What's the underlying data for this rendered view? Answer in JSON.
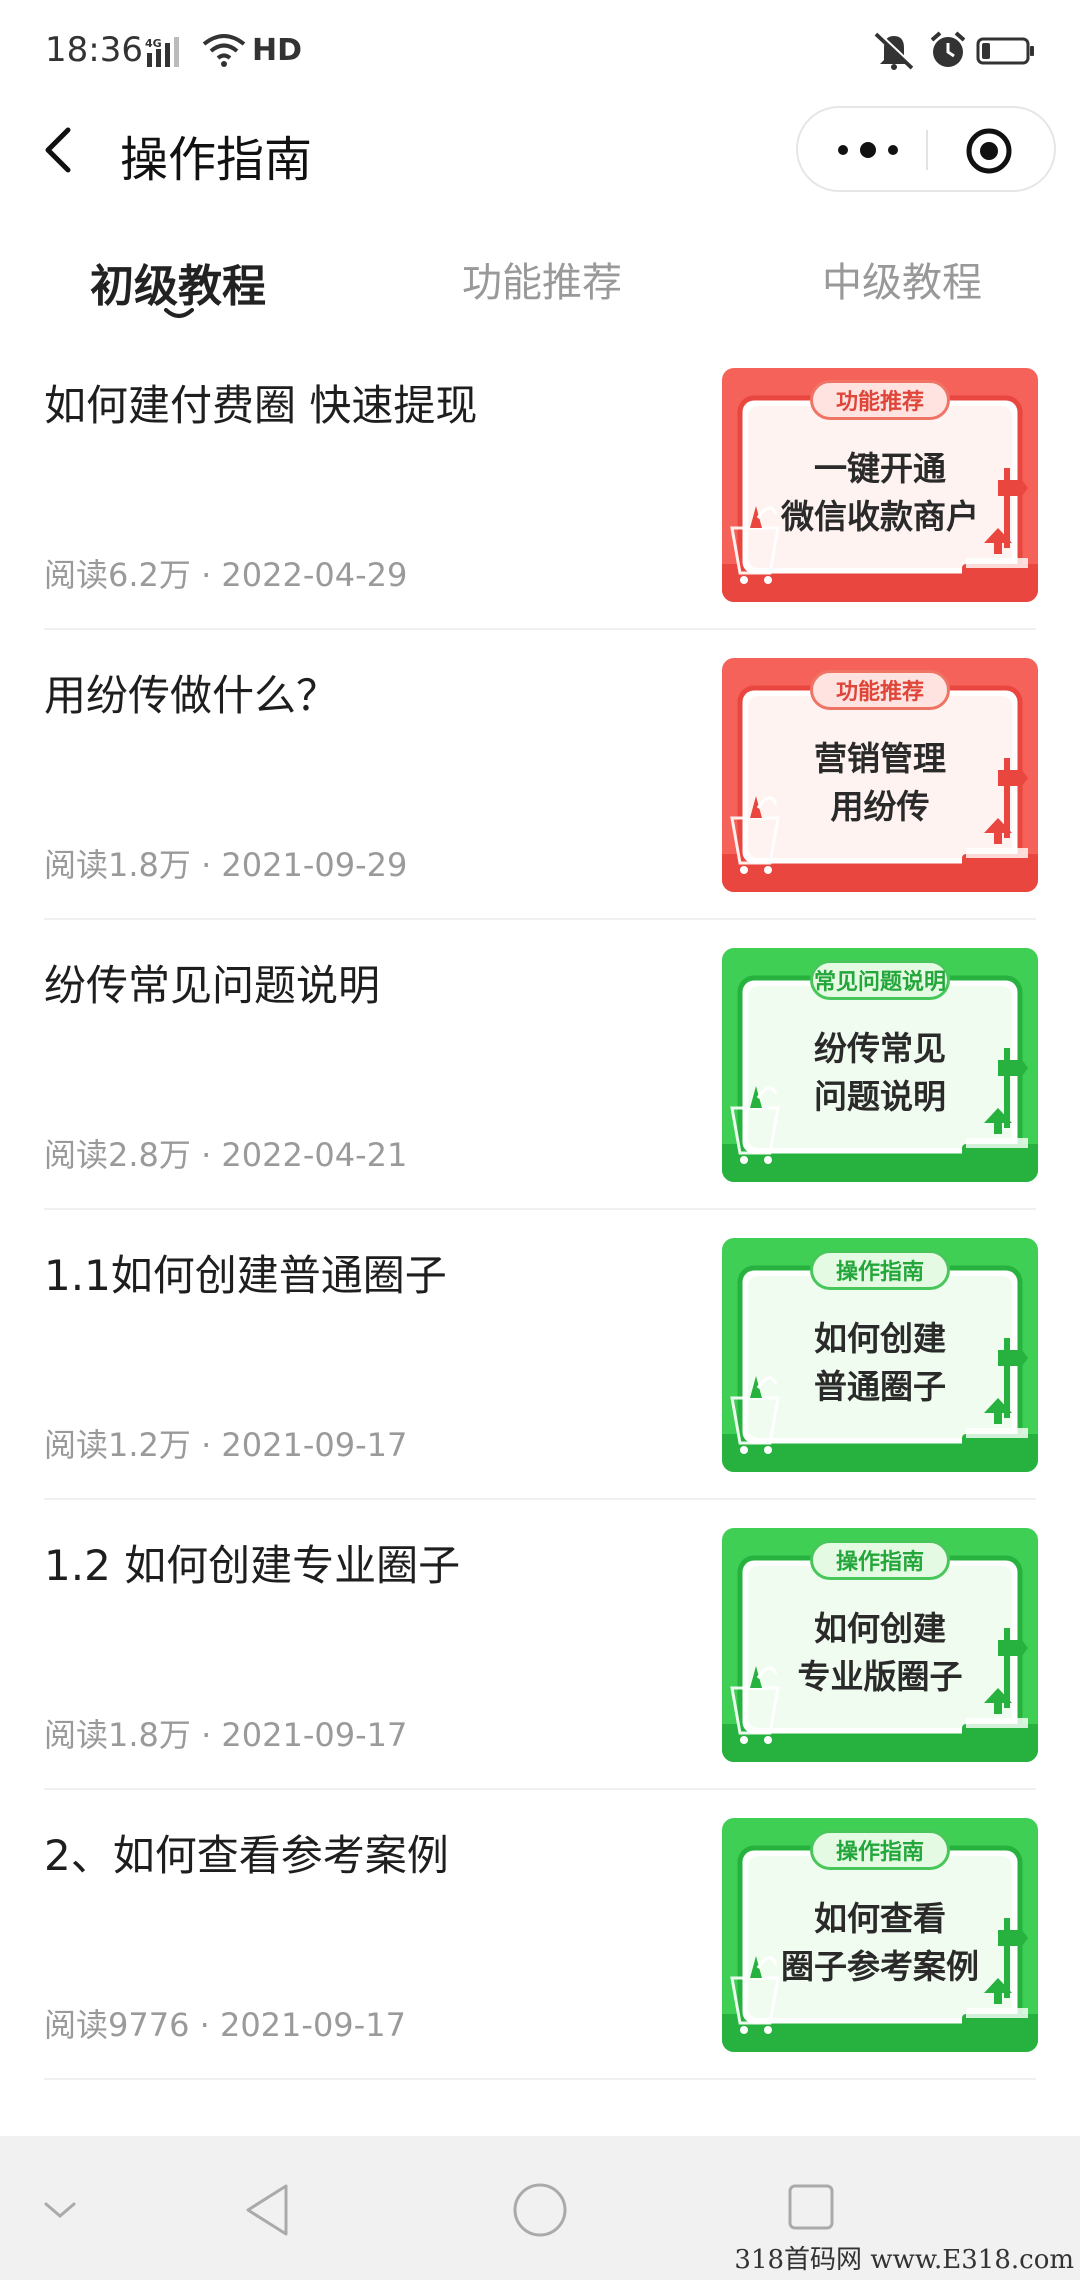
{
  "status_bar": {
    "time": "18:36",
    "network": "4G",
    "hd_label": "HD",
    "icons": [
      "signal-icon",
      "wifi-icon",
      "mute-icon",
      "alarm-icon",
      "battery-icon"
    ]
  },
  "header": {
    "title": "操作指南",
    "back_icon": "chevron-left-icon",
    "more_icon": "more-icon",
    "close_icon": "target-close-icon"
  },
  "tabs": [
    {
      "label": "初级教程",
      "active": true
    },
    {
      "label": "功能推荐",
      "active": false
    },
    {
      "label": "中级教程",
      "active": false
    }
  ],
  "articles": [
    {
      "title": "如何建付费圈 快速提现",
      "meta": "阅读6.2万 · 2022-04-29",
      "thumb": {
        "theme": "red",
        "badge": "功能推荐",
        "line1": "一键开通",
        "line2": "微信收款商户"
      }
    },
    {
      "title": "用纷传做什么？",
      "meta": "阅读1.8万 · 2021-09-29",
      "thumb": {
        "theme": "red",
        "badge": "功能推荐",
        "line1": "营销管理",
        "line2": "用纷传"
      }
    },
    {
      "title": "纷传常见问题说明",
      "meta": "阅读2.8万 · 2022-04-21",
      "thumb": {
        "theme": "green",
        "badge": "常见问题说明",
        "line1": "纷传常见",
        "line2": "问题说明"
      }
    },
    {
      "title": "1.1如何创建普通圈子",
      "meta": "阅读1.2万 · 2021-09-17",
      "thumb": {
        "theme": "green",
        "badge": "操作指南",
        "line1": "如何创建",
        "line2": "普通圈子"
      }
    },
    {
      "title": "1.2 如何创建专业圈子",
      "meta": "阅读1.8万 · 2021-09-17",
      "thumb": {
        "theme": "green",
        "badge": "操作指南",
        "line1": "如何创建",
        "line2": "专业版圈子"
      }
    },
    {
      "title": "2、如何查看参考案例",
      "meta": "阅读9776 · 2021-09-17",
      "thumb": {
        "theme": "green",
        "badge": "操作指南",
        "line1": "如何查看",
        "line2": "圈子参考案例"
      }
    }
  ],
  "nav_bar": {
    "icons": [
      "chevron-down-icon",
      "back-triangle-icon",
      "home-circle-icon",
      "recents-square-icon"
    ]
  },
  "watermark": "318首码网 www.E318.com",
  "colors": {
    "red_theme": "#f4625a",
    "green_theme": "#3fcf55",
    "text_primary": "#1e1e1e",
    "text_secondary": "#9a9a9a",
    "tab_inactive": "#999999"
  }
}
